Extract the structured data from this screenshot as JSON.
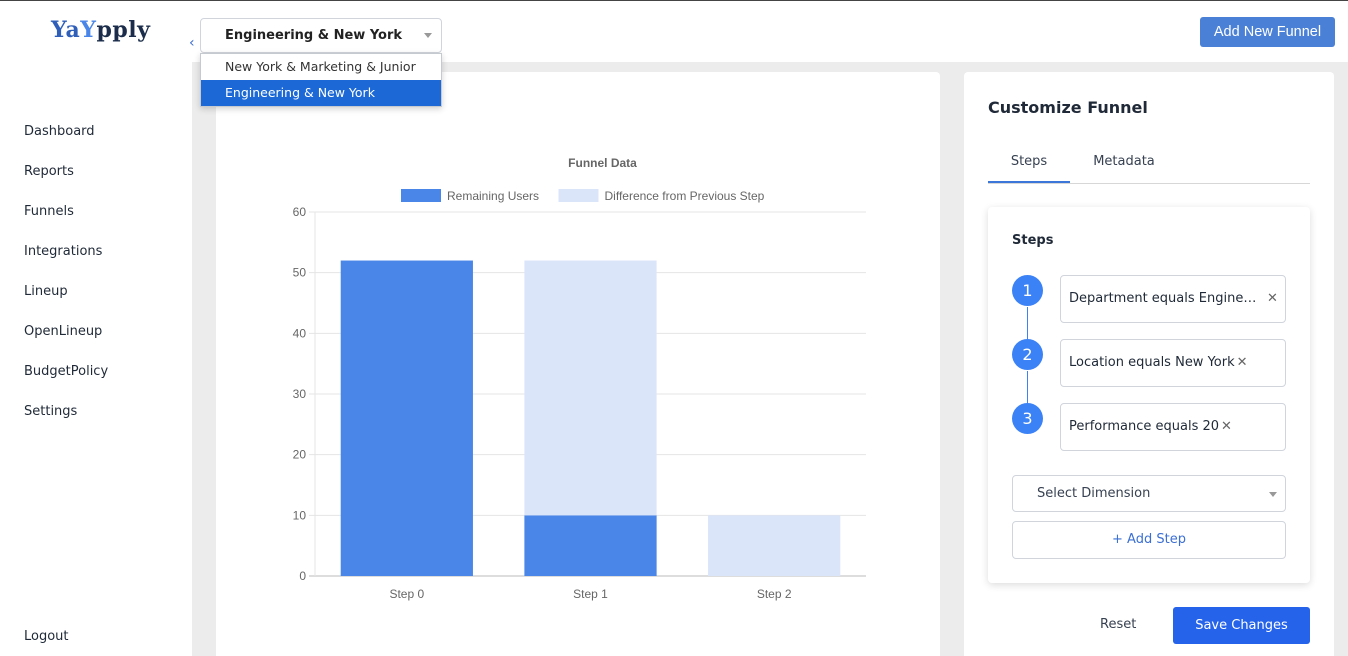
{
  "app": {
    "logo_part1": "Ya",
    "logo_part2": "Y",
    "logo_part3": "pply"
  },
  "sidebar": {
    "items": [
      {
        "label": "Dashboard"
      },
      {
        "label": "Reports"
      },
      {
        "label": "Funnels"
      },
      {
        "label": "Integrations"
      },
      {
        "label": "Lineup"
      },
      {
        "label": "OpenLineup"
      },
      {
        "label": "BudgetPolicy"
      },
      {
        "label": "Settings"
      }
    ],
    "logout": "Logout",
    "collapse_icon": "chevron-left-icon"
  },
  "funnel_select": {
    "value": "Engineering & New York",
    "options": [
      "New York & Marketing & Junior",
      "Engineering & New York"
    ],
    "selected_index": 1
  },
  "header": {
    "add_funnel_label": "Add New Funnel"
  },
  "chart_data": {
    "type": "bar",
    "stacked": true,
    "title": "Funnel Data",
    "categories": [
      "Step 0",
      "Step 1",
      "Step 2"
    ],
    "series": [
      {
        "name": "Remaining Users",
        "values": [
          52,
          10,
          0
        ],
        "color": "#4a86e8"
      },
      {
        "name": "Difference from Previous Step",
        "values": [
          0,
          42,
          10
        ],
        "color": "#dbe5fa"
      }
    ],
    "ylim": [
      0,
      60
    ],
    "yticks": [
      0,
      10,
      20,
      30,
      40,
      50,
      60
    ],
    "grid": true,
    "legend": "top"
  },
  "panel": {
    "title": "Customize Funnel",
    "tabs": [
      {
        "label": "Steps",
        "active": true
      },
      {
        "label": "Metadata",
        "active": false
      }
    ],
    "steps_title": "Steps",
    "steps": [
      {
        "num": "1",
        "text": "Department equals Engineering"
      },
      {
        "num": "2",
        "text": "Location equals New York"
      },
      {
        "num": "3",
        "text": "Performance equals 20"
      }
    ],
    "select_dimension": "Select Dimension",
    "add_step": "+ Add Step",
    "reset": "Reset",
    "save": "Save Changes"
  }
}
